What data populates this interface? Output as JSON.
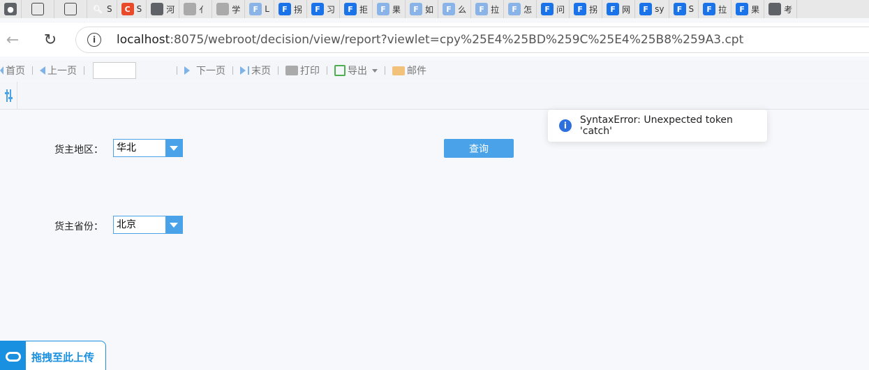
{
  "browser": {
    "tabs": [
      {
        "icon": "user-icon",
        "label": ""
      },
      {
        "icon": "copy-icon",
        "label": ""
      },
      {
        "icon": "sidebar-icon",
        "label": ""
      },
      {
        "icon": "search-icon",
        "label": "S"
      },
      {
        "icon": "c-logo-icon",
        "label": "S"
      },
      {
        "icon": "globe-icon",
        "label": "河"
      },
      {
        "icon": "globe-icon",
        "label": "亻"
      },
      {
        "icon": "globe-icon",
        "label": "学"
      },
      {
        "icon": "finereport-icon",
        "label": "L"
      },
      {
        "icon": "finereport-icon",
        "label": "拐"
      },
      {
        "icon": "finereport-icon",
        "label": "习"
      },
      {
        "icon": "finereport-icon",
        "label": "拒"
      },
      {
        "icon": "finereport-icon",
        "label": "果"
      },
      {
        "icon": "finereport-icon",
        "label": "如"
      },
      {
        "icon": "finereport-icon",
        "label": "么"
      },
      {
        "icon": "finereport-icon",
        "label": "拉"
      },
      {
        "icon": "finereport-icon",
        "label": "怎"
      },
      {
        "icon": "finereport-icon",
        "label": "问"
      },
      {
        "icon": "finereport-icon",
        "label": "拐"
      },
      {
        "icon": "finereport-icon",
        "label": "网"
      },
      {
        "icon": "finereport-icon",
        "label": "sy"
      },
      {
        "icon": "finereport-icon",
        "label": "S"
      },
      {
        "icon": "finereport-icon",
        "label": "拉"
      },
      {
        "icon": "finereport-icon",
        "label": "果"
      },
      {
        "icon": "globe-icon",
        "label": "考"
      }
    ],
    "url_host": "localhost",
    "url_rest": ":8075/webroot/decision/view/report?viewlet=cpy%25E4%25BD%259C%25E4%25B8%259A3.cpt"
  },
  "toolbar": {
    "first": "首页",
    "prev": "上一页",
    "page_value": "",
    "next": "下一页",
    "last": "末页",
    "print": "打印",
    "export": "导出",
    "mail": "邮件"
  },
  "form": {
    "region_label": "货主地区：",
    "region_value": "华北",
    "province_label": "货主省份：",
    "province_value": "北京",
    "query_label": "查询"
  },
  "toast": {
    "message": "SyntaxError: Unexpected token 'catch'"
  },
  "upload": {
    "label": "拖拽至此上传"
  },
  "colors": {
    "accent": "#4aa3e8",
    "upload_blue": "#1a90e0",
    "toast_icon": "#2e6fe0"
  }
}
